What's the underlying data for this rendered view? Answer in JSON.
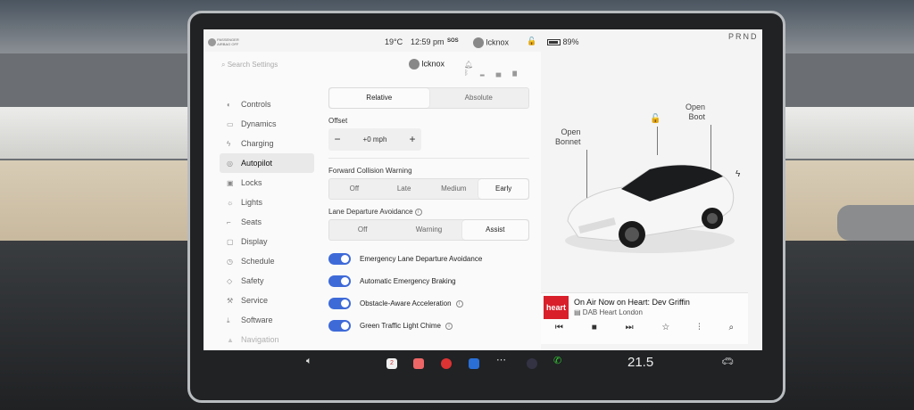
{
  "status_bar": {
    "airbag": [
      "PASSENGER",
      "AIRBAG OFF"
    ],
    "temperature": "19°C",
    "time": "12:59 pm",
    "sos": "SOS",
    "user": "lcknox",
    "battery": "89%",
    "battery_level": 0.89,
    "gear": "PRND"
  },
  "header": {
    "search_placeholder": "Search Settings",
    "profile_name": "lcknox"
  },
  "sidebar": {
    "items": [
      {
        "label": "Controls",
        "icon": "toggle-icon"
      },
      {
        "label": "Dynamics",
        "icon": "car-icon"
      },
      {
        "label": "Charging",
        "icon": "bolt-icon"
      },
      {
        "label": "Autopilot",
        "icon": "steering-wheel-icon",
        "active": true
      },
      {
        "label": "Locks",
        "icon": "lock-icon"
      },
      {
        "label": "Lights",
        "icon": "sun-icon"
      },
      {
        "label": "Seats",
        "icon": "seat-icon"
      },
      {
        "label": "Display",
        "icon": "display-icon"
      },
      {
        "label": "Schedule",
        "icon": "clock-icon"
      },
      {
        "label": "Safety",
        "icon": "shield-icon"
      },
      {
        "label": "Service",
        "icon": "wrench-icon"
      },
      {
        "label": "Software",
        "icon": "download-icon"
      },
      {
        "label": "Navigation",
        "icon": "navigation-icon"
      }
    ]
  },
  "autopilot": {
    "mode_options": [
      "Relative",
      "Absolute"
    ],
    "mode_selected": "Relative",
    "offset_label": "Offset",
    "offset_minus": "−",
    "offset_value": "+0 mph",
    "offset_plus": "+",
    "fcw_label": "Forward Collision Warning",
    "fcw_options": [
      "Off",
      "Late",
      "Medium",
      "Early"
    ],
    "fcw_selected": "Early",
    "lda_label": "Lane Departure Avoidance",
    "lda_options": [
      "Off",
      "Warning",
      "Assist"
    ],
    "lda_selected": "Assist",
    "toggles": [
      {
        "label": "Emergency Lane Departure Avoidance",
        "on": true,
        "info": false
      },
      {
        "label": "Automatic Emergency Braking",
        "on": true,
        "info": false
      },
      {
        "label": "Obstacle-Aware Acceleration",
        "on": true,
        "info": true
      },
      {
        "label": "Green Traffic Light Chime",
        "on": true,
        "info": true
      }
    ]
  },
  "vehicle": {
    "bonnet_label": [
      "Open",
      "Bonnet"
    ],
    "boot_label": [
      "Open",
      "Boot"
    ]
  },
  "media": {
    "station_logo": "heart",
    "title": "On Air Now on Heart: Dev Griffin",
    "subtitle": "DAB Heart London"
  },
  "dock": {
    "cabin_temperature": "21.5",
    "calendar_day": "2"
  },
  "colors": {
    "toggle_on": "#3e6ad8",
    "heart_red": "#d81f2a"
  }
}
